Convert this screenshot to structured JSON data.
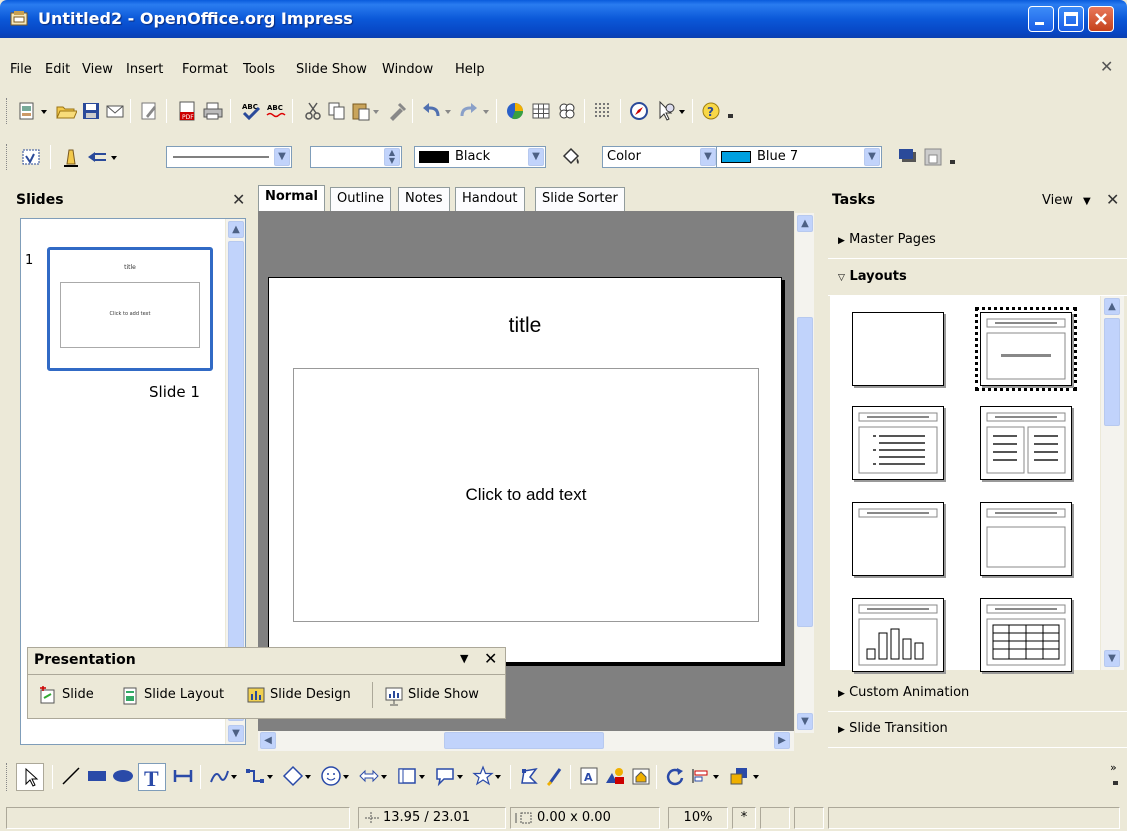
{
  "window": {
    "title": "Untitled2 - OpenOffice.org Impress"
  },
  "menu": [
    "File",
    "Edit",
    "View",
    "Insert",
    "Format",
    "Tools",
    "Slide Show",
    "Window",
    "Help"
  ],
  "line_toolbar": {
    "line_style": "",
    "line_width": "",
    "line_color": "Black",
    "area_style": "Color",
    "area_fill": "Blue 7"
  },
  "slides_pane": {
    "title": "Slides",
    "slides": [
      {
        "number": "1",
        "label": "Slide 1",
        "thumb_title": "title",
        "thumb_body": "Click to add text"
      }
    ]
  },
  "tabs": [
    "Normal",
    "Outline",
    "Notes",
    "Handout",
    "Slide Sorter"
  ],
  "slide": {
    "title": "title",
    "body": "Click to add text"
  },
  "tasks_pane": {
    "title": "Tasks",
    "view_label": "View",
    "sections": {
      "master_pages": "Master Pages",
      "layouts": "Layouts",
      "custom_animation": "Custom Animation",
      "slide_transition": "Slide Transition"
    }
  },
  "presentation_bar": {
    "title": "Presentation",
    "buttons": [
      "Slide",
      "Slide Layout",
      "Slide Design",
      "Slide Show"
    ]
  },
  "status": {
    "position": "13.95 / 23.01",
    "size": "0.00 x 0.00",
    "zoom": "10%",
    "modified": "*"
  },
  "colors": {
    "titlebar": "#0a5bdc",
    "area_fill": "#00a0e0",
    "scroll": "#c1d3fb"
  }
}
